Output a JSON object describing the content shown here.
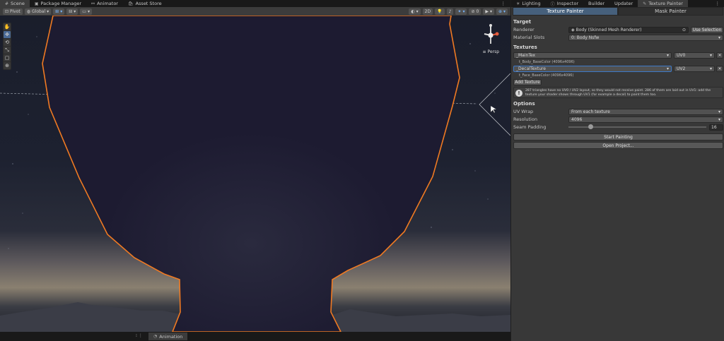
{
  "left_tabs": [
    {
      "icon": "#",
      "label": "Scene",
      "active": true
    },
    {
      "icon": "▣",
      "label": "Package Manager"
    },
    {
      "icon": "⚯",
      "label": "Animator"
    },
    {
      "icon": "🛍",
      "label": "Asset Store"
    }
  ],
  "right_tabs": [
    {
      "icon": "☀",
      "label": "Lighting"
    },
    {
      "icon": "ⓘ",
      "label": "Inspector"
    },
    {
      "icon": "",
      "label": "Builder"
    },
    {
      "icon": "",
      "label": "Updater"
    },
    {
      "icon": "✎",
      "label": "Texture Painter",
      "active": true
    }
  ],
  "toolbar": {
    "pivot_label": "Pivot",
    "global_label": "Global",
    "mode_2d": "2D"
  },
  "scene": {
    "persp_label": "Persp"
  },
  "bottom": {
    "animation_tab": "Animation"
  },
  "panel": {
    "subtabs": [
      "Texture Painter",
      "Mask Painter"
    ],
    "target_heading": "Target",
    "renderer_label": "Renderer",
    "renderer_value": "Body (Skinned Mesh Renderer)",
    "use_selection": "Use Selection",
    "material_slots_label": "Material Slots",
    "material_slots_value": "0: Body Nsfw",
    "textures_heading": "Textures",
    "textures": [
      {
        "prop": "_MainTex",
        "uv": "UV0",
        "asset": "t_Body_BaseColor  (4096x4096)"
      },
      {
        "prop": "_DecalTexture",
        "uv": "UV2",
        "asset": "t_Face_BaseColor  (4096x4096)"
      }
    ],
    "add_texture": "Add Texture",
    "info_text": "287 triangles have no UV0 / UV2 layout, so they would not receive paint. 286 of them are laid out in UV1: add the texture your shader shows through UV1 (for example a decal) to paint them too.",
    "options_heading": "Options",
    "uv_wrap_label": "UV Wrap",
    "uv_wrap_value": "From each texture",
    "resolution_label": "Resolution",
    "resolution_value": "4096",
    "seam_padding_label": "Seam Padding",
    "seam_padding_value": "16",
    "seam_padding_fraction": 0.16,
    "start_painting": "Start Painting",
    "open_project": "Open Project..."
  }
}
